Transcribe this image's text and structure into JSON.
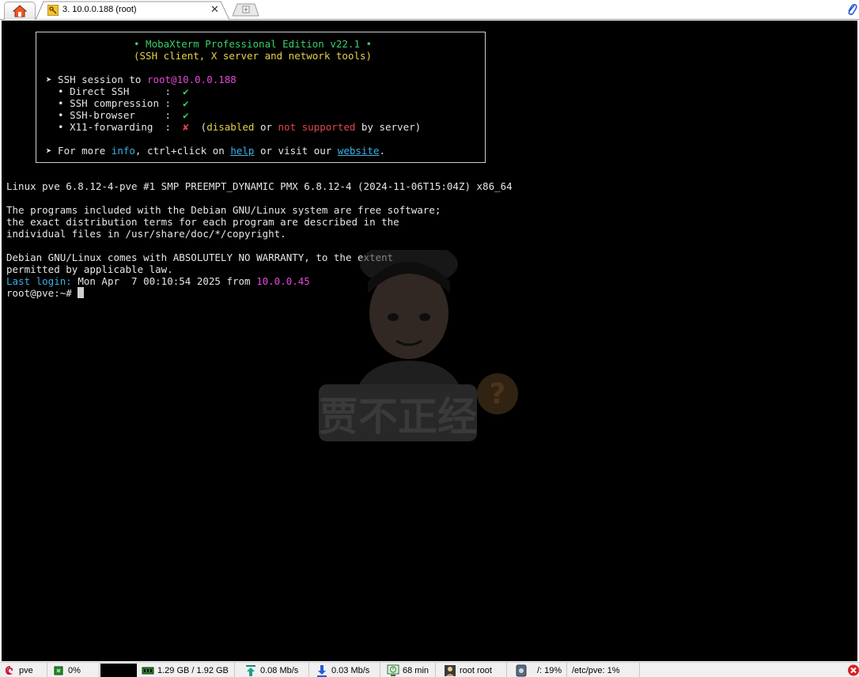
{
  "tabs": {
    "home_icon": "home-icon",
    "session_label": "3. 10.0.0.188 (root)",
    "close_label": "✕",
    "newtab_icon": "new-tab-icon"
  },
  "terminal": {
    "banner": {
      "title": "• MobaXterm Professional Edition v22.1 •",
      "subtitle": "(SSH client, X server and network tools)",
      "ssh_prefix": "➤ SSH session to ",
      "ssh_target": "root@10.0.0.188",
      "direct_ssh": "  • Direct SSH      :  ",
      "ssh_compression": "  • SSH compression :  ",
      "ssh_browser": "  • SSH-browser     :  ",
      "x11": "  • X11-forwarding  :  ",
      "check": "✔",
      "cross": "✘",
      "x11_open": "  (",
      "disabled": "disabled",
      "or": " or ",
      "not_supported": "not supported",
      "by_server": " by server)",
      "more_prefix": "➤ For more ",
      "info": "info",
      "more_mid1": ", ctrl+click on ",
      "help": "help",
      "more_mid2": " or visit our ",
      "website": "website",
      "more_end": "."
    },
    "uname": "Linux pve 6.8.12-4-pve #1 SMP PREEMPT_DYNAMIC PMX 6.8.12-4 (2024-11-06T15:04Z) x86_64",
    "motd1": "The programs included with the Debian GNU/Linux system are free software;",
    "motd2": "the exact distribution terms for each program are described in the",
    "motd3": "individual files in /usr/share/doc/*/copyright.",
    "motd4": "Debian GNU/Linux comes with ABSOLUTELY NO WARRANTY, to the extent",
    "motd5": "permitted by applicable law.",
    "last_login_label": "Last login:",
    "last_login_text": " Mon Apr  7 00:10:54 2025 from ",
    "last_login_ip": "10.0.0.45",
    "prompt": "root@pve:~# "
  },
  "watermark": {
    "text": "贾不正经"
  },
  "statusbar": {
    "host": "pve",
    "cpu": "0%",
    "memory": "1.29 GB / 1.92 GB",
    "upload": "0.08 Mb/s",
    "download": "0.03 Mb/s",
    "uptime": "68 min",
    "users": "root  root",
    "disk_root": "/: 19%",
    "disk_etc": "/etc/pve: 1%"
  },
  "colors": {
    "terminal_bg": "#000000",
    "green": "#3ad06a",
    "yellow": "#e6d04a",
    "magenta": "#e04ad8",
    "red": "#e0464a",
    "cyan": "#3cb0e6"
  }
}
